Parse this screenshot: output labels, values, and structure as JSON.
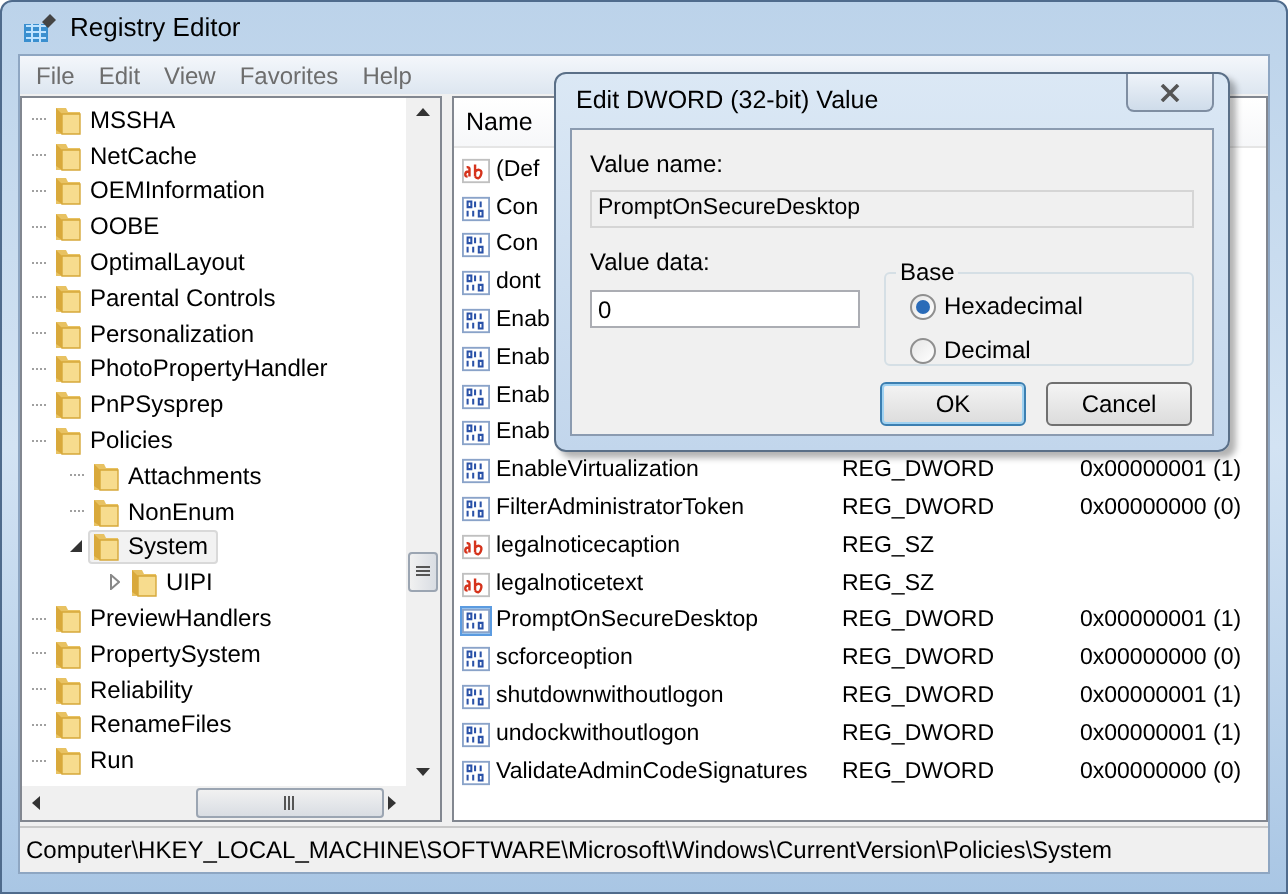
{
  "window": {
    "title": "Registry Editor"
  },
  "menu": [
    "File",
    "Edit",
    "View",
    "Favorites",
    "Help"
  ],
  "tree": [
    {
      "label": "MSSHA",
      "selected": false
    },
    {
      "label": "NetCache",
      "selected": false
    },
    {
      "label": "OEMInformation",
      "selected": false
    },
    {
      "label": "OOBE",
      "selected": false
    },
    {
      "label": "OptimalLayout",
      "selected": false
    },
    {
      "label": "Parental Controls",
      "selected": false
    },
    {
      "label": "Personalization",
      "selected": false
    },
    {
      "label": "PhotoPropertyHandler",
      "selected": false
    },
    {
      "label": "PnPSysprep",
      "selected": false
    },
    {
      "label": "Policies",
      "selected": false,
      "children": [
        {
          "label": "Attachments",
          "selected": false
        },
        {
          "label": "NonEnum",
          "selected": false
        },
        {
          "label": "System",
          "selected": true,
          "expanded": true,
          "children": [
            {
              "label": "UIPI",
              "selected": false,
              "expanded": false
            }
          ]
        }
      ]
    },
    {
      "label": "PreviewHandlers",
      "selected": false
    },
    {
      "label": "PropertySystem",
      "selected": false
    },
    {
      "label": "Reliability",
      "selected": false
    },
    {
      "label": "RenameFiles",
      "selected": false
    },
    {
      "label": "Run",
      "selected": false
    }
  ],
  "values": {
    "columns": [
      "Name"
    ],
    "rows": [
      {
        "kind": "sz",
        "name": "(Def",
        "selected": false
      },
      {
        "kind": "dword",
        "name": "Con",
        "selected": false
      },
      {
        "kind": "dword",
        "name": "Con",
        "selected": false
      },
      {
        "kind": "dword",
        "name": "dont",
        "selected": false
      },
      {
        "kind": "dword",
        "name": "Enab",
        "selected": false
      },
      {
        "kind": "dword",
        "name": "Enab",
        "selected": false
      },
      {
        "kind": "dword",
        "name": "Enab",
        "selected": false
      },
      {
        "kind": "dword",
        "name": "Enab",
        "selected": false
      },
      {
        "kind": "dword",
        "name": "EnableVirtualization",
        "type": "REG_DWORD",
        "data": "0x00000001 (1)",
        "selected": false
      },
      {
        "kind": "dword",
        "name": "FilterAdministratorToken",
        "type": "REG_DWORD",
        "data": "0x00000000 (0)",
        "selected": false
      },
      {
        "kind": "sz",
        "name": "legalnoticecaption",
        "type": "REG_SZ",
        "selected": false
      },
      {
        "kind": "sz",
        "name": "legalnoticetext",
        "type": "REG_SZ",
        "selected": false
      },
      {
        "kind": "dword",
        "name": "PromptOnSecureDesktop",
        "type": "REG_DWORD",
        "data": "0x00000001 (1)",
        "selected": true
      },
      {
        "kind": "dword",
        "name": "scforceoption",
        "type": "REG_DWORD",
        "data": "0x00000000 (0)",
        "selected": false
      },
      {
        "kind": "dword",
        "name": "shutdownwithoutlogon",
        "type": "REG_DWORD",
        "data": "0x00000001 (1)",
        "selected": false
      },
      {
        "kind": "dword",
        "name": "undockwithoutlogon",
        "type": "REG_DWORD",
        "data": "0x00000001 (1)",
        "selected": false
      },
      {
        "kind": "dword",
        "name": "ValidateAdminCodeSignatures",
        "type": "REG_DWORD",
        "data": "0x00000000 (0)",
        "selected": false
      }
    ]
  },
  "status_bar": "Computer\\HKEY_LOCAL_MACHINE\\SOFTWARE\\Microsoft\\Windows\\CurrentVersion\\Policies\\System",
  "dialog": {
    "title": "Edit DWORD (32-bit) Value",
    "value_name_label": "Value name:",
    "value_name": "PromptOnSecureDesktop",
    "value_data_label": "Value data:",
    "value_data": "0",
    "base_label": "Base",
    "base_options": [
      {
        "label": "Hexadecimal",
        "selected": true
      },
      {
        "label": "Decimal",
        "selected": false
      }
    ],
    "buttons": [
      {
        "label": "OK",
        "default": true
      },
      {
        "label": "Cancel",
        "default": false
      }
    ]
  }
}
